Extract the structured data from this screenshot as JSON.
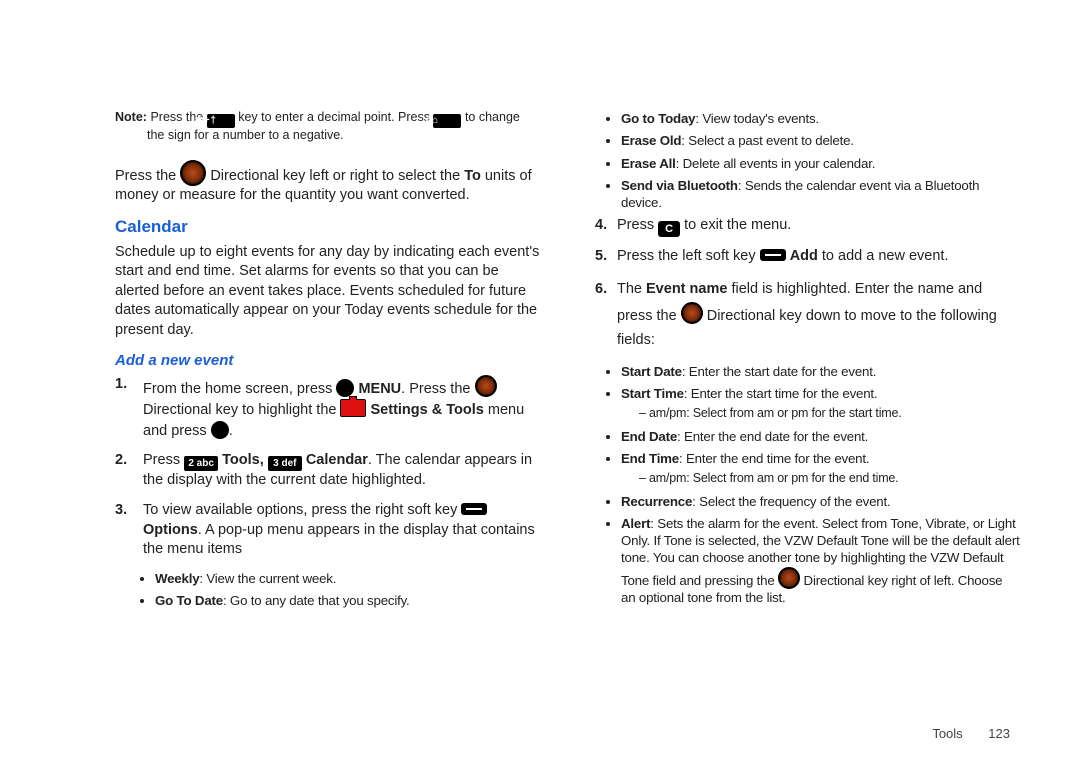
{
  "left": {
    "note_label": "Note:",
    "note_text_a": "Press the",
    "note_text_b": "key to enter a decimal point. Press",
    "note_text_c": "to change the sign for a number to a negative.",
    "key_star": "✱ + †",
    "key_hash": "# ⌂",
    "press_the": "Press the",
    "dir_para_a": "Directional key left or right to select the ",
    "dir_para_to": "To",
    "dir_para_b": " units of money or measure for the quantity you want converted.",
    "h2_calendar": "Calendar",
    "calendar_para": "Schedule up to eight events for any day by indicating each event's start and end time. Set alarms for events so that you can be alerted before an event takes place. Events scheduled for future dates automatically appear on your Today events schedule for the present day.",
    "h3_add": "Add a new event",
    "steps": {
      "1": {
        "num": "1.",
        "a": "From the home screen, press",
        "menu": "MENU",
        "b": ". Press the",
        "c": "Directional key to highlight the",
        "settings": "Settings & Tools",
        "d": "menu and press",
        "e": "."
      },
      "2": {
        "num": "2.",
        "a": "Press",
        "key2": "2 abc",
        "tools": "Tools,",
        "key3": "3 def",
        "cal": "Calendar",
        "b": ". The calendar appears in the display with the current date highlighted."
      },
      "3": {
        "num": "3.",
        "a": "To view available options, press the right soft key",
        "opt": "Options",
        "b": ". A pop-up menu appears in the display that contains the menu items"
      }
    },
    "sub_bullets": {
      "weekly_b": "Weekly",
      "weekly_t": ": View the current week.",
      "goto_b": "Go To Date",
      "goto_t": ": Go to any date that you specify."
    }
  },
  "right": {
    "top_bullets": {
      "today_b": "Go to Today",
      "today_t": ": View today's events.",
      "eraseold_b": "Erase Old",
      "eraseold_t": ": Select a past event to delete.",
      "eraseall_b": "Erase All",
      "eraseall_t": ": Delete all events in your calendar.",
      "bt_b": "Send via Bluetooth",
      "bt_t": ": Sends the calendar event via a Bluetooth device."
    },
    "steps": {
      "4": {
        "num": "4.",
        "a": "Press",
        "clr": "C",
        "b": "to exit the menu."
      },
      "5": {
        "num": "5.",
        "a": "Press the left soft key",
        "add": "Add",
        "b": " to add a new event."
      },
      "6": {
        "num": "6.",
        "a": "The ",
        "ev": "Event name",
        "b": " field is highlighted. Enter the name and press the",
        "c": "Directional key down to move to the following fields:"
      }
    },
    "fields": {
      "sd_b": "Start Date",
      "sd_t": ": Enter the start date for the event.",
      "st_b": "Start Time",
      "st_t": ": Enter the start time for the event.",
      "st_sub": "– am/pm: Select from am or pm for the start time.",
      "ed_b": "End Date",
      "ed_t": ": Enter the end date for the event.",
      "et_b": "End Time",
      "et_t": ": Enter the end time for the event.",
      "et_sub": "– am/pm: Select from am or pm for the end time.",
      "rec_b": "Recurrence",
      "rec_t": ": Select the frequency of the event.",
      "al_b": "Alert",
      "al_t1": ": Sets the alarm for the event. Select from Tone, Vibrate, or Light Only. If Tone is selected, the VZW Default Tone will be the default alert tone. You can choose another tone by highlighting the VZW Default Tone field and pressing the",
      "al_t2": "Directional key right of left. Choose an optional tone from the list."
    }
  },
  "footer": {
    "section": "Tools",
    "page": "123"
  }
}
